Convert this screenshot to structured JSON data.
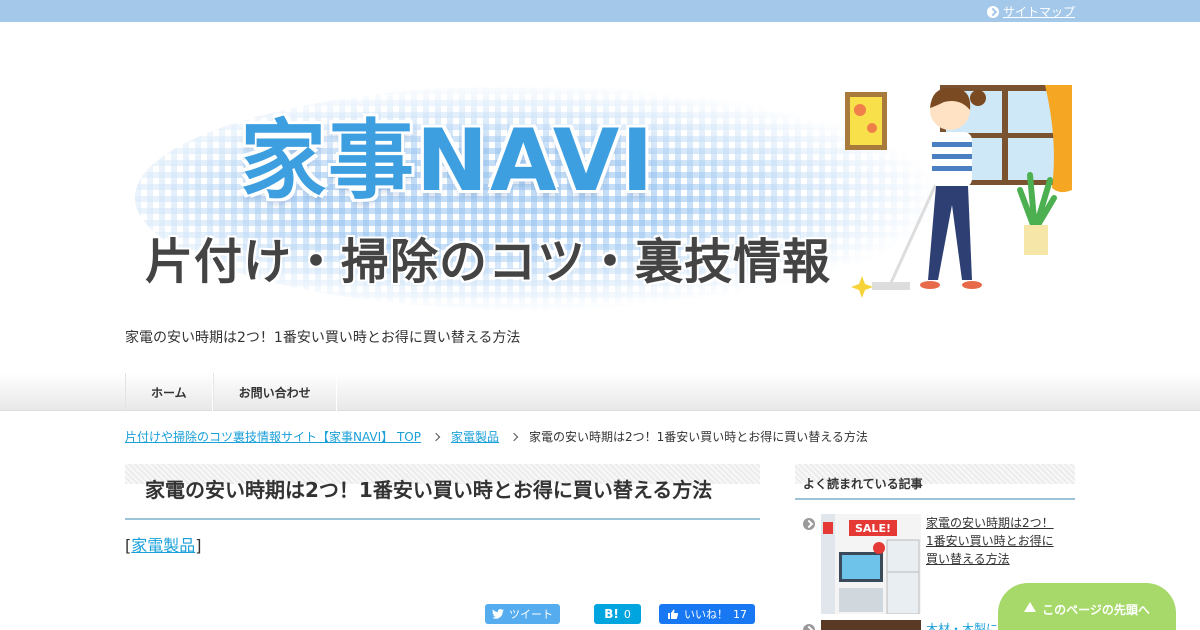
{
  "header": {
    "sitemap_label": "サイトマップ",
    "logo_main": "家事NAVI",
    "logo_sub": "片付け・掃除のコツ・裏技情報",
    "tagline": "家電の安い時期は2つ！1番安い買い時とお得に買い替える方法"
  },
  "nav": {
    "items": [
      {
        "label": "ホーム"
      },
      {
        "label": "お問い合わせ"
      }
    ]
  },
  "breadcrumb": {
    "home": "片付けや掃除のコツ裏技情報サイト【家事NAVI】 TOP",
    "category": "家電製品",
    "current": "家電の安い時期は2つ！1番安い買い時とお得に買い替える方法"
  },
  "article": {
    "title": "家電の安い時期は2つ！1番安い買い時とお得に買い替える方法",
    "category_open": "[",
    "category": "家電製品",
    "category_close": "]"
  },
  "share": {
    "tweet_label": "ツイート",
    "hatena_label": "B!",
    "hatena_count": "0",
    "like_label": "いいね！",
    "like_count": "17"
  },
  "sidebar": {
    "popular_heading": "よく読まれている記事",
    "popular": [
      {
        "title": "家電の安い時期は2つ！1番安い買い時とお得に買い替える方法",
        "thumb_badge": "SALE!"
      },
      {
        "title": "木材・木製に"
      }
    ]
  },
  "back_to_top": "このページの先頭へ",
  "colors": {
    "topbar": "#a4c8ea",
    "link": "#1a9fd9",
    "accent_line": "#9cc4d6",
    "back_to_top": "#a6d96a",
    "logo_blue": "#3d9fe0"
  }
}
